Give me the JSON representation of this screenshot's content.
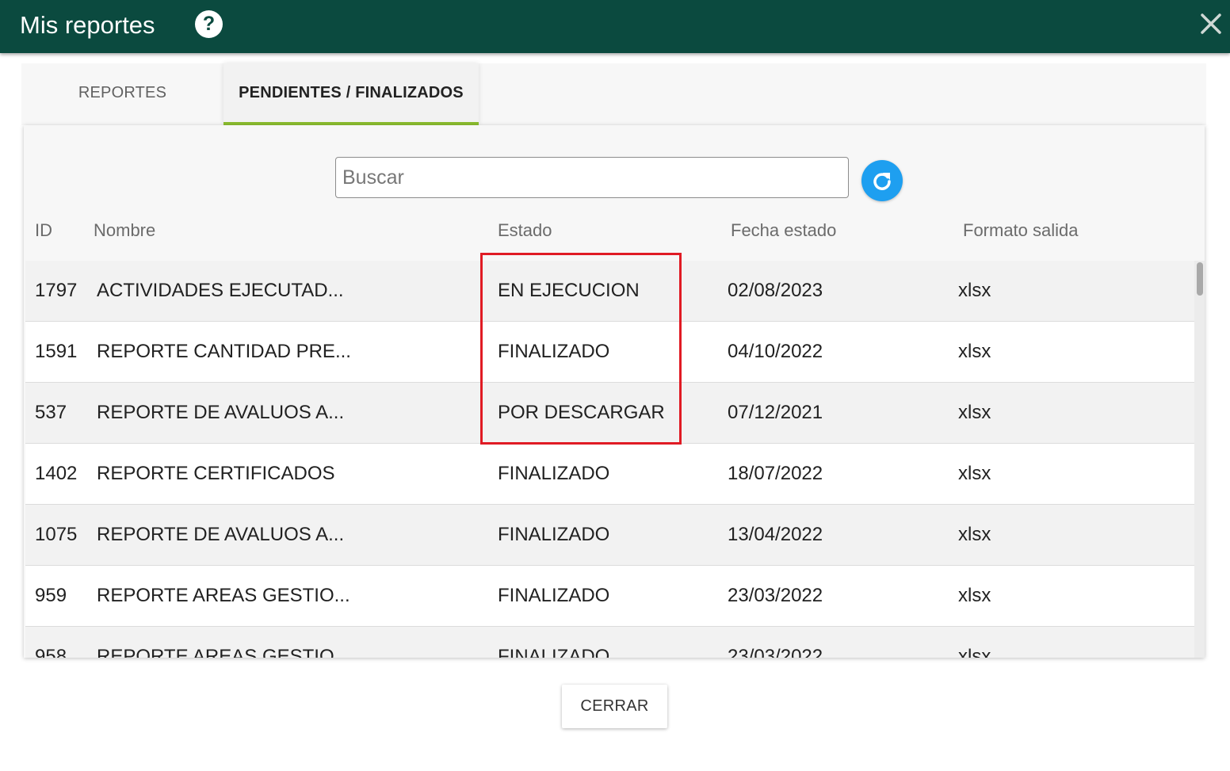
{
  "window": {
    "title": "Mis reportes",
    "help_icon": "question-circle-icon",
    "close_icon": "close-x-icon",
    "header_color": "#0b4a3f"
  },
  "tabs": [
    {
      "label": "REPORTES",
      "active": false
    },
    {
      "label": "PENDIENTES / FINALIZADOS",
      "active": true
    }
  ],
  "accent_color": "#8bbd2f",
  "search": {
    "placeholder": "Buscar",
    "value": ""
  },
  "refresh_button": {
    "icon": "refresh-icon",
    "color": "#1e9ff0"
  },
  "table": {
    "columns": [
      "ID",
      "Nombre",
      "Estado",
      "Fecha estado",
      "Formato salida"
    ],
    "rows": [
      {
        "id": "1797",
        "nombre": "ACTIVIDADES EJECUTAD...",
        "estado": "EN EJECUCION",
        "fecha": "02/08/2023",
        "formato": "xlsx"
      },
      {
        "id": "1591",
        "nombre": "REPORTE CANTIDAD PRE...",
        "estado": "FINALIZADO",
        "fecha": "04/10/2022",
        "formato": "xlsx"
      },
      {
        "id": "537",
        "nombre": "REPORTE DE AVALUOS A...",
        "estado": "POR DESCARGAR",
        "fecha": "07/12/2021",
        "formato": "xlsx"
      },
      {
        "id": "1402",
        "nombre": "REPORTE CERTIFICADOS",
        "estado": "FINALIZADO",
        "fecha": "18/07/2022",
        "formato": "xlsx"
      },
      {
        "id": "1075",
        "nombre": "REPORTE DE AVALUOS A...",
        "estado": "FINALIZADO",
        "fecha": "13/04/2022",
        "formato": "xlsx"
      },
      {
        "id": "959",
        "nombre": "REPORTE AREAS GESTIO...",
        "estado": "FINALIZADO",
        "fecha": "23/03/2022",
        "formato": "xlsx"
      },
      {
        "id": "958",
        "nombre": "REPORTE AREAS GESTIO...",
        "estado": "FINALIZADO",
        "fecha": "23/03/2022",
        "formato": "xlsx"
      }
    ]
  },
  "annotation": {
    "color": "#e01b24"
  },
  "footer": {
    "close_label": "CERRAR"
  }
}
